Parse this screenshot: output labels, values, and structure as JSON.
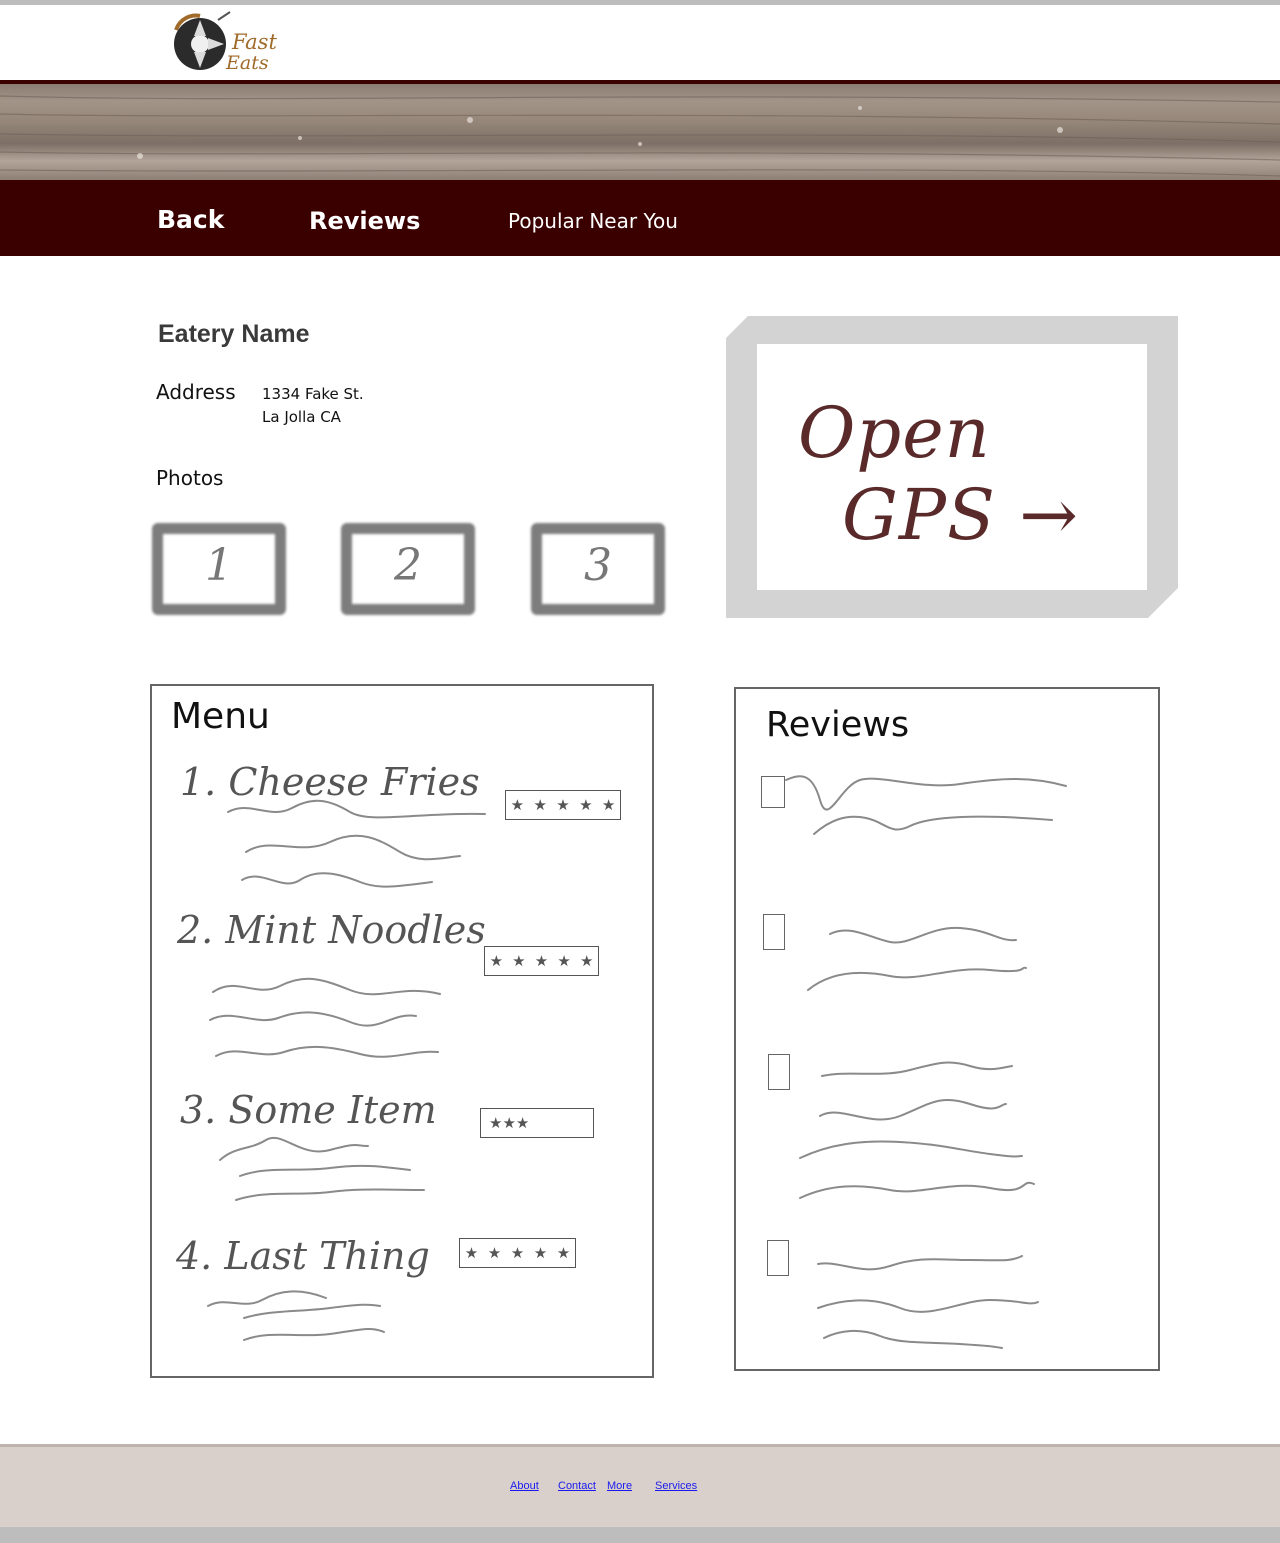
{
  "logo": {
    "line1": "Fast",
    "line2": "Eats"
  },
  "nav": {
    "back": "Back",
    "reviews": "Reviews",
    "popular": "Popular Near You"
  },
  "eatery": {
    "name": "Eatery Name",
    "address_label": "Address",
    "address_line_1": "1334 Fake St.",
    "address_line_2": "La Jolla CA",
    "photos_label": "Photos",
    "photos": [
      "1",
      "2",
      "3"
    ]
  },
  "gps": {
    "line1": "Open",
    "line2": "GPS →"
  },
  "menu": {
    "title": "Menu",
    "items": [
      "1. Cheese Fries",
      "2. Mint Noodles",
      "3. Some Item",
      "4. Last Thing"
    ],
    "ratings": [
      5,
      5,
      2.5,
      5
    ]
  },
  "reviews": {
    "title": "Reviews",
    "count": 4
  },
  "footer": {
    "about": "About",
    "contact": "Contact",
    "more": "More",
    "services": "Services"
  },
  "colors": {
    "brand_dark": "#3a0000",
    "footer_bg": "#d9d0cb",
    "link": "#1a1aee"
  }
}
